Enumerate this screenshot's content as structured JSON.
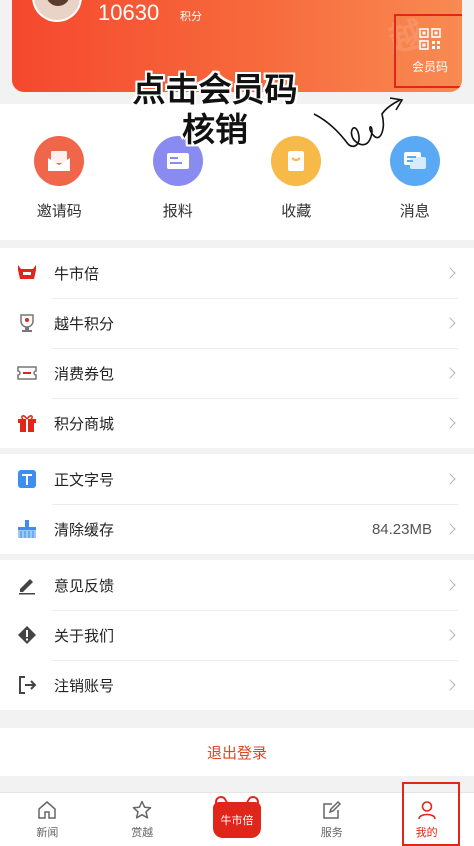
{
  "header": {
    "points_value": "10630",
    "points_unit": "积分",
    "member_code_label": "会员码"
  },
  "annotation": {
    "line1": "点击会员码",
    "line2": "核销"
  },
  "quick_actions": [
    {
      "label": "邀请码",
      "icon": "envelope-icon",
      "color": "#f0664a"
    },
    {
      "label": "报料",
      "icon": "report-icon",
      "color": "#8a8bf0"
    },
    {
      "label": "收藏",
      "icon": "bookmark-icon",
      "color": "#f7b948"
    },
    {
      "label": "消息",
      "icon": "message-icon",
      "color": "#5aa9f5"
    }
  ],
  "menu_group_1": [
    {
      "label": "牛市倍",
      "icon": "bull-logo-icon"
    },
    {
      "label": "越牛积分",
      "icon": "trophy-icon"
    },
    {
      "label": "消费券包",
      "icon": "coupon-icon"
    },
    {
      "label": "积分商城",
      "icon": "gift-icon"
    }
  ],
  "menu_group_2": [
    {
      "label": "正文字号",
      "icon": "font-size-icon"
    },
    {
      "label": "清除缓存",
      "icon": "broom-icon",
      "value": "84.23MB"
    }
  ],
  "menu_group_3": [
    {
      "label": "意见反馈",
      "icon": "pencil-icon"
    },
    {
      "label": "关于我们",
      "icon": "info-diamond-icon"
    },
    {
      "label": "注销账号",
      "icon": "logout-icon"
    }
  ],
  "logout_label": "退出登录",
  "tabbar": [
    {
      "label": "新闻",
      "icon": "home-icon"
    },
    {
      "label": "赏越",
      "icon": "star-icon"
    },
    {
      "label": "",
      "icon": "bull-center-icon"
    },
    {
      "label": "服务",
      "icon": "edit-icon"
    },
    {
      "label": "我的",
      "icon": "user-icon",
      "active": true
    }
  ],
  "center_logo_text": "牛市倍"
}
